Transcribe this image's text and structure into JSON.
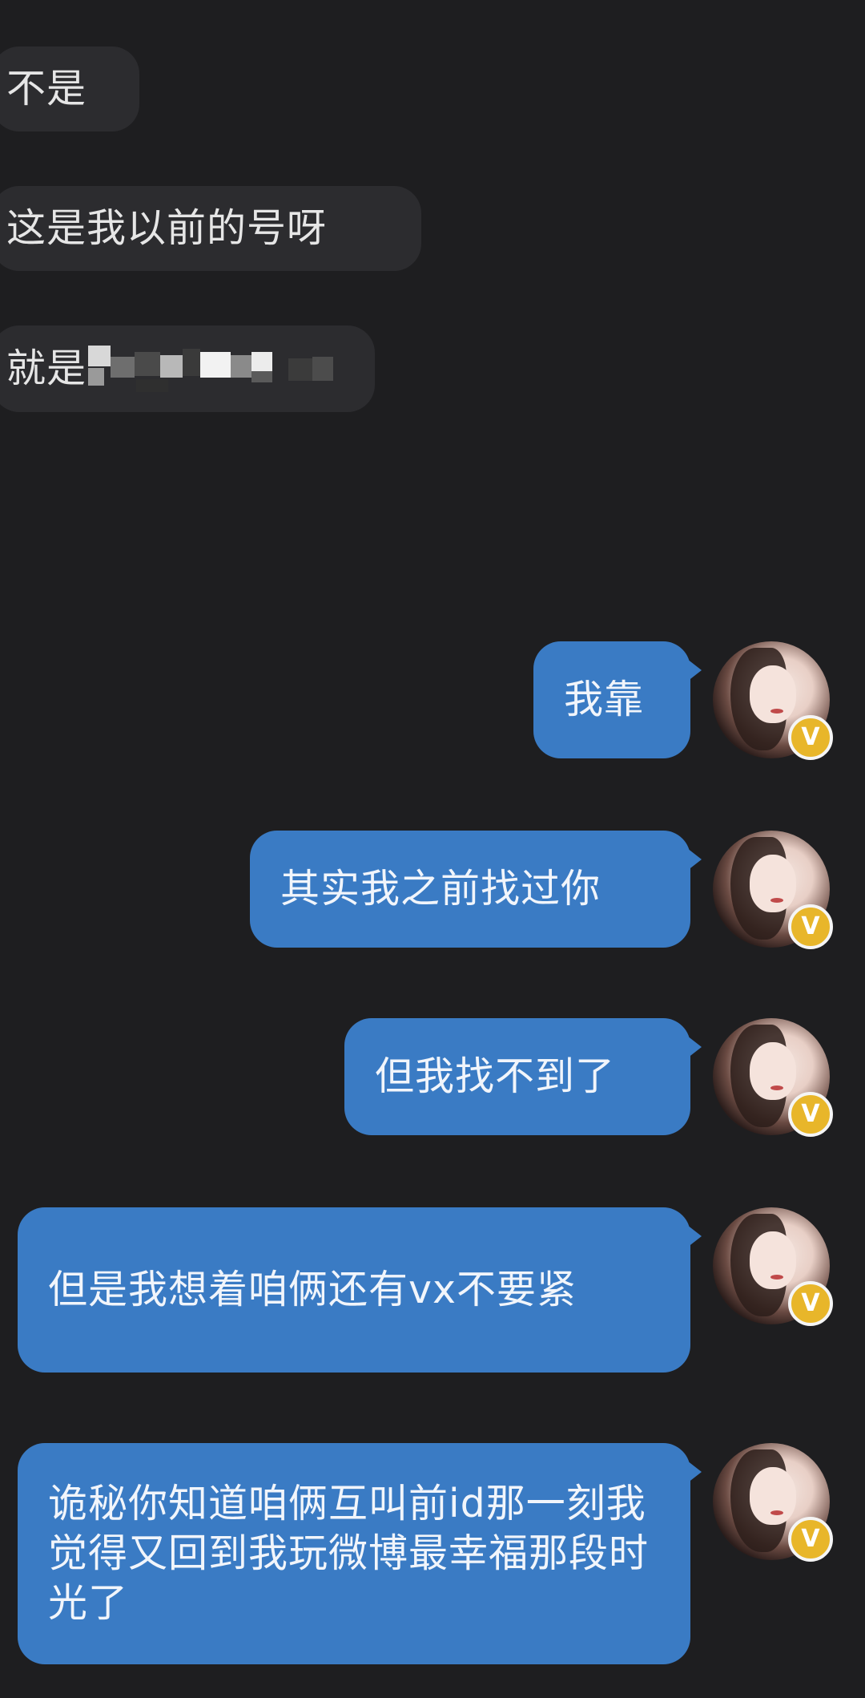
{
  "conversation": {
    "incoming": [
      {
        "text": "不是"
      },
      {
        "text": "这是我以前的号呀"
      },
      {
        "text": "就是"
      }
    ],
    "outgoing": [
      {
        "text": "我靠"
      },
      {
        "text": "其实我之前找过你"
      },
      {
        "text": "但我找不到了"
      },
      {
        "text": "但是我想着咱俩还有vx不要紧"
      },
      {
        "text": "诡秘你知道咱俩互叫前id那一刻我觉得又回到我玩微博最幸福那段时光了"
      }
    ]
  },
  "avatar": {
    "badge_label": "V",
    "badge_color": "#e8b62a",
    "outgoing_bubble_color": "#3a7bc4",
    "incoming_bubble_color": "#2c2c2f",
    "background_color": "#1e1e20"
  }
}
